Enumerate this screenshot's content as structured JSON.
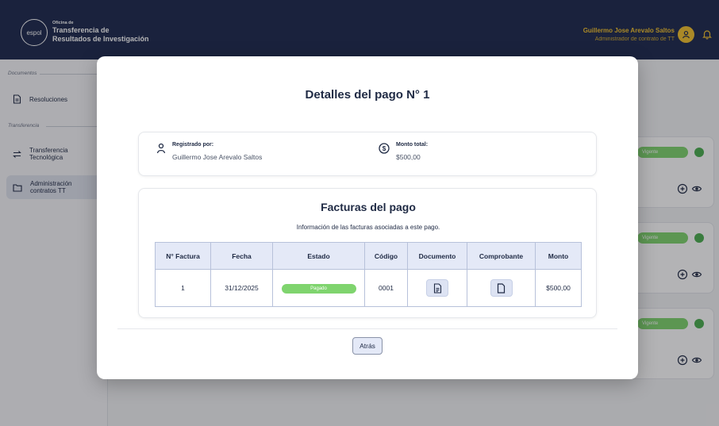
{
  "header": {
    "brand_small": "Oficina de",
    "brand_line1": "Transferencia de",
    "brand_line2": "Resultados de Investigación",
    "logo_text": "espol",
    "user_name": "Guillermo Jose Arevalo Saltos",
    "user_role": "Administrador de contrato de TT"
  },
  "sidebar": {
    "section_documents": "Documentos",
    "section_transfer": "Transferencia",
    "items": [
      {
        "label": "Resoluciones"
      },
      {
        "label1": "Transferencia",
        "label2": "Tecnológica"
      },
      {
        "label1": "Administración",
        "label2": "contratos TT"
      }
    ]
  },
  "background_cards": {
    "status_label": "Vigente"
  },
  "modal": {
    "title": "Detalles del pago N° 1",
    "registered_by_label": "Registrado por:",
    "registered_by_value": "Guillermo Jose Arevalo Saltos",
    "total_label": "Monto total:",
    "total_value": "$500,00",
    "invoices_title": "Facturas del pago",
    "invoices_subtitle": "Información de las facturas asociadas a este pago.",
    "columns": [
      "N° Factura",
      "Fecha",
      "Estado",
      "Código",
      "Documento",
      "Comprobante",
      "Monto"
    ],
    "rows": [
      {
        "numero": "1",
        "fecha": "31/12/2025",
        "estado": "Pagado",
        "codigo": "0001",
        "monto": "$500,00"
      }
    ],
    "back_button": "Atrás"
  }
}
